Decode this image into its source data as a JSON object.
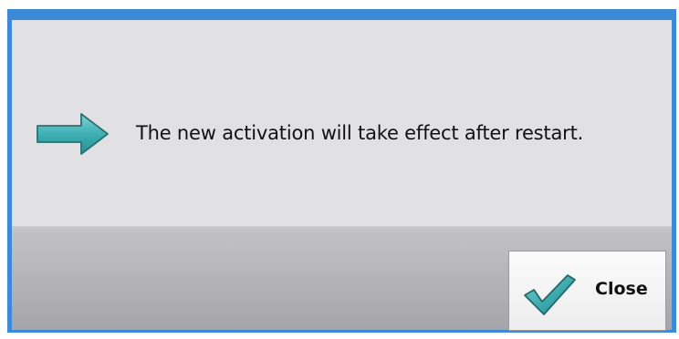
{
  "dialog": {
    "message": "The new activation will take effect after restart.",
    "message_icon": "right-arrow-icon",
    "close_button": {
      "label": "Close",
      "icon": "checkmark-icon"
    }
  },
  "colors": {
    "window_border": "#3c89d6",
    "accent_teal": "#3aa6aa",
    "message_background": "#e1e1e3"
  }
}
